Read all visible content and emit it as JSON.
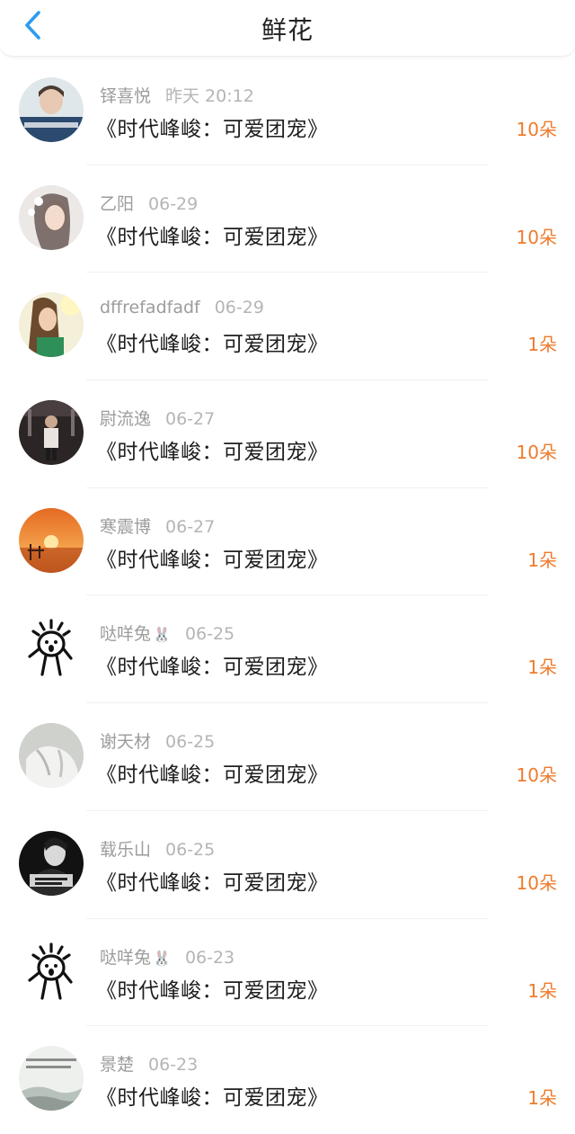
{
  "header": {
    "title": "鲜花",
    "back_icon": "chevron-left-icon",
    "accent": "#2d9bf0"
  },
  "colors": {
    "count": "#ee7b2c",
    "name": "#9c9c9c",
    "date": "#b5b5b5"
  },
  "rows": [
    {
      "name": "铎喜悦",
      "date": "昨天 20:12",
      "book": "《时代峰峻：可爱团宠》",
      "count": "10朵",
      "avatar": "portrait-avatar"
    },
    {
      "name": "乙阳",
      "date": "06-29",
      "book": "《时代峰峻：可爱团宠》",
      "count": "10朵",
      "avatar": "portrait-avatar"
    },
    {
      "name": "dffrefadfadf",
      "date": "06-29",
      "book": "《时代峰峻：可爱团宠》",
      "count": "1朵",
      "avatar": "portrait-avatar"
    },
    {
      "name": "尉流逸",
      "date": "06-27",
      "book": "《时代峰峻：可爱团宠》",
      "count": "10朵",
      "avatar": "photo-avatar"
    },
    {
      "name": "寒震博",
      "date": "06-27",
      "book": "《时代峰峻：可爱团宠》",
      "count": "1朵",
      "avatar": "sunset-avatar"
    },
    {
      "name": "哒咩兔",
      "emoji": "🐰",
      "date": "06-25",
      "book": "《时代峰峻：可爱团宠》",
      "count": "1朵",
      "avatar": "cartoon-avatar"
    },
    {
      "name": "谢天材",
      "date": "06-25",
      "book": "《时代峰峻：可爱团宠》",
      "count": "10朵",
      "avatar": "photo-avatar"
    },
    {
      "name": "载乐山",
      "date": "06-25",
      "book": "《时代峰峻：可爱团宠》",
      "count": "10朵",
      "avatar": "dark-photo-avatar"
    },
    {
      "name": "哒咩兔",
      "emoji": "🐰",
      "date": "06-23",
      "book": "《时代峰峻：可爱团宠》",
      "count": "1朵",
      "avatar": "cartoon-avatar"
    },
    {
      "name": "景楚",
      "date": "06-23",
      "book": "《时代峰峻：可爱团宠》",
      "count": "1朵",
      "avatar": "landscape-avatar"
    }
  ]
}
